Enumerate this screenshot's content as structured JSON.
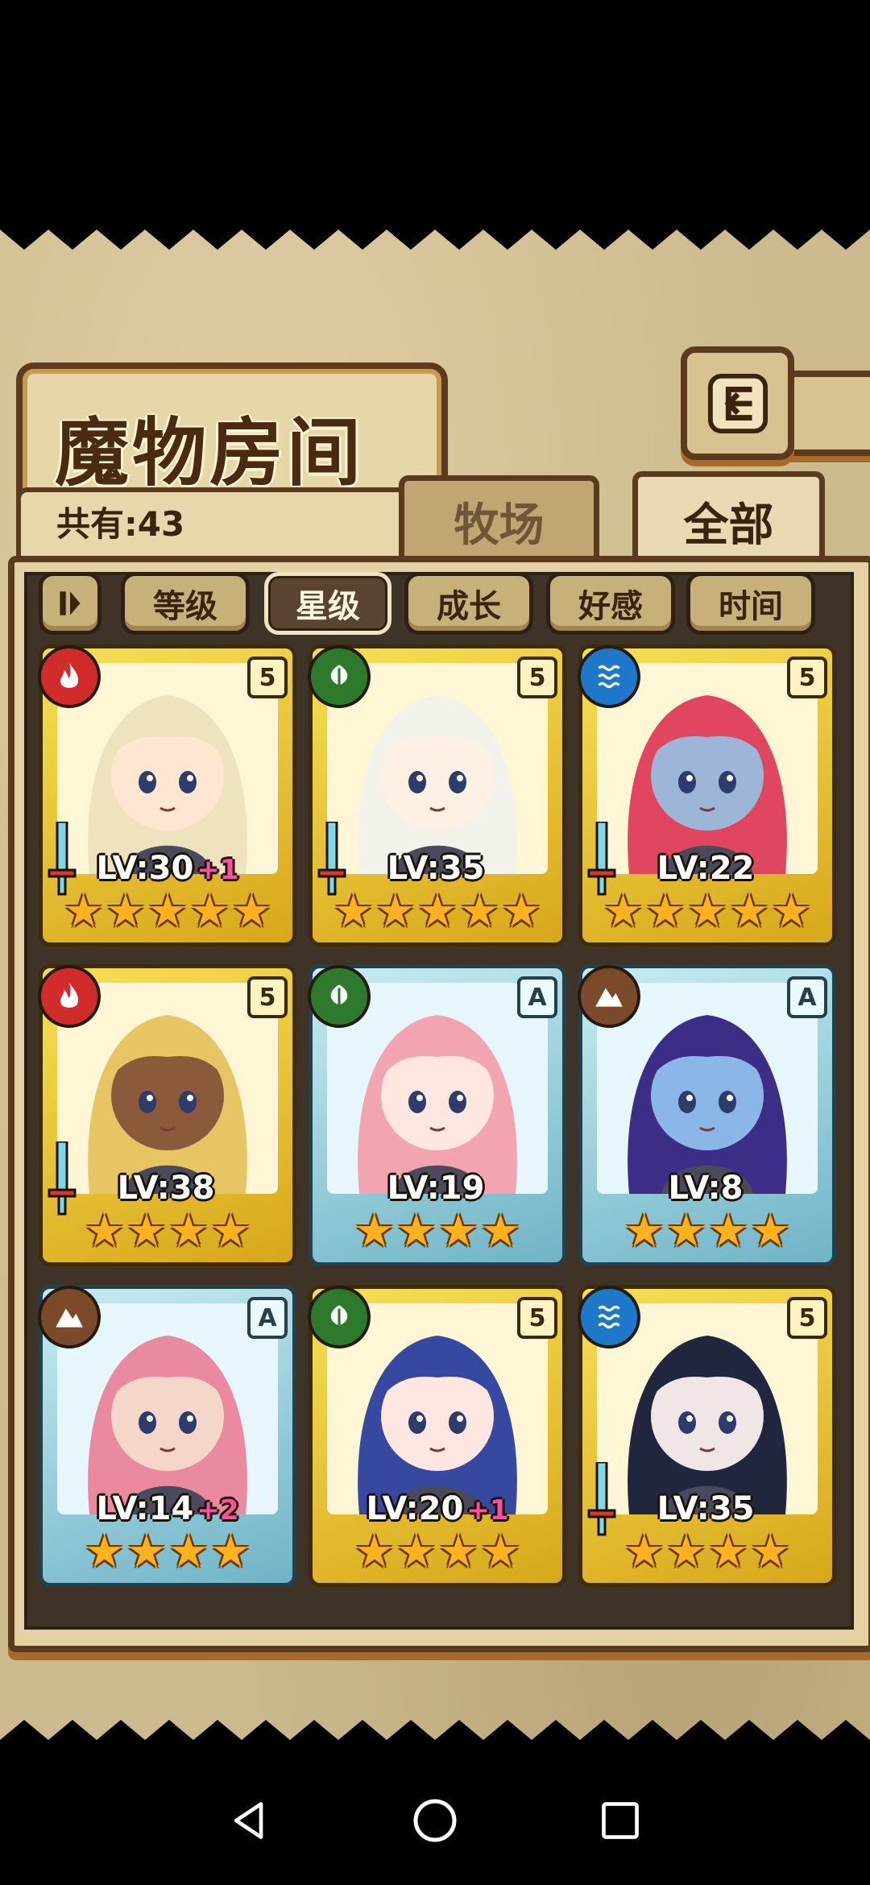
{
  "title": "魔物房间",
  "count_text": "共有:43",
  "tabs": [
    {
      "label": "牧场",
      "active": false
    },
    {
      "label": "全部",
      "active": true
    }
  ],
  "sort_buttons": [
    {
      "label": "等级",
      "selected": false
    },
    {
      "label": "星级",
      "selected": true
    },
    {
      "label": "成长",
      "selected": false
    },
    {
      "label": "好感",
      "selected": false
    },
    {
      "label": "时间",
      "selected": false
    }
  ],
  "cards": [
    {
      "level": "LV:30",
      "bonus": "+1",
      "element": "fire",
      "rank": "5",
      "frame": "gold",
      "stars": 5,
      "has_sword": true,
      "hair": "#efe3bf",
      "skin": "#ffe6d0"
    },
    {
      "level": "LV:35",
      "bonus": "",
      "element": "leaf",
      "rank": "5",
      "frame": "gold",
      "stars": 5,
      "has_sword": true,
      "hair": "#f2f2ea",
      "skin": "#fff0e4"
    },
    {
      "level": "LV:22",
      "bonus": "",
      "element": "water",
      "rank": "5",
      "frame": "gold",
      "stars": 5,
      "has_sword": true,
      "hair": "#e0465f",
      "skin": "#9db6d8"
    },
    {
      "level": "LV:38",
      "bonus": "",
      "element": "fire",
      "rank": "5",
      "frame": "gold",
      "stars": 4,
      "has_sword": true,
      "hair": "#e7c565",
      "skin": "#8a5a3a"
    },
    {
      "level": "LV:19",
      "bonus": "",
      "element": "leaf",
      "rank": "A",
      "frame": "blue",
      "stars": 4,
      "has_sword": false,
      "hair": "#f2a5b0",
      "skin": "#ffe6de"
    },
    {
      "level": "LV:8",
      "bonus": "",
      "element": "earth",
      "rank": "A",
      "frame": "blue",
      "stars": 4,
      "has_sword": false,
      "hair": "#3c2e86",
      "skin": "#8ab6e8"
    },
    {
      "level": "LV:14",
      "bonus": "+2",
      "element": "earth",
      "rank": "A",
      "frame": "blue",
      "stars": 4,
      "has_sword": false,
      "hair": "#e98aa0",
      "skin": "#f4d7c8"
    },
    {
      "level": "LV:20",
      "bonus": "+1",
      "element": "leaf",
      "rank": "5",
      "frame": "gold",
      "stars": 4,
      "has_sword": false,
      "hair": "#3748a0",
      "skin": "#ffe6e0"
    },
    {
      "level": "LV:35",
      "bonus": "",
      "element": "water",
      "rank": "5",
      "frame": "gold",
      "stars": 4,
      "has_sword": true,
      "hair": "#20263e",
      "skin": "#f1e6e6"
    }
  ],
  "colors": {
    "fire": "#d22b2b",
    "leaf": "#2d7a2d",
    "water": "#1d78c9",
    "earth": "#7a4a2a",
    "frame_border": "#5b3a1d",
    "parchment": "#cdbb8f"
  },
  "icons": {
    "back": "return-arrow-icon",
    "sort_toggle": "sort-toggle-icon",
    "nav": [
      "back-triangle-icon",
      "home-circle-icon",
      "recents-square-icon"
    ]
  }
}
